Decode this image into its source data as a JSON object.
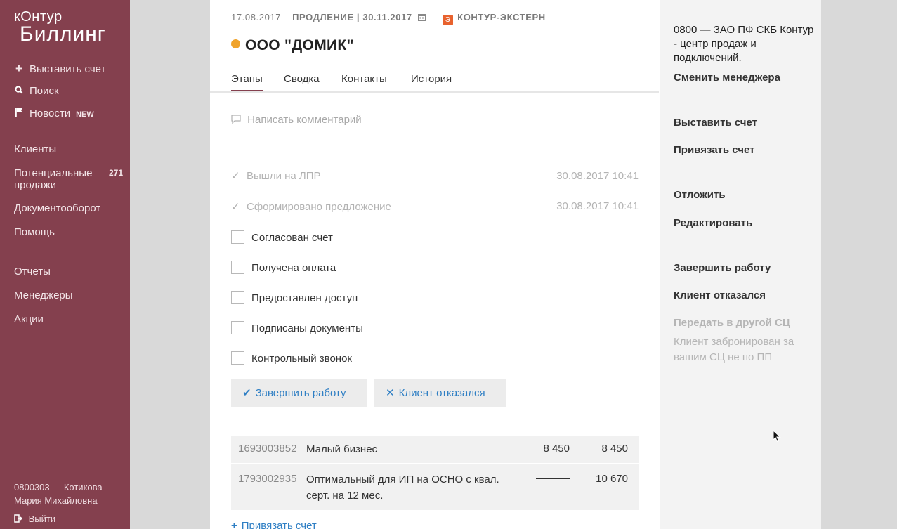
{
  "sidebar": {
    "logo_small": "кОнтур",
    "logo_big": "Биллинг",
    "create_invoice": "Выставить счет",
    "search": "Поиск",
    "news": "Новости",
    "news_badge": "NEW",
    "clients": "Клиенты",
    "potential_sales_line1": "Потенциальные",
    "potential_sales_line2": "продажи",
    "potential_sales_count": "271",
    "docflow": "Документооборот",
    "help": "Помощь",
    "reports": "Отчеты",
    "managers": "Менеджеры",
    "promotions": "Акции",
    "user_line1": "0800303 — Котикова",
    "user_line2": "Мария Михайловна",
    "logout": "Выйти"
  },
  "header": {
    "date": "17.08.2017",
    "renewal": "ПРОДЛЕНИЕ | 30.11.2017",
    "product": "КОНТУР-ЭКСТЕРН",
    "product_icon": "Э",
    "company": "ООО \"ДОМИК\"",
    "status_color": "#f0a32b"
  },
  "tabs": [
    "Этапы",
    "Сводка",
    "Контакты",
    "История"
  ],
  "comment_placeholder": "Написать комментарий",
  "done_steps": [
    {
      "label": "Вышли на ЛПР",
      "time": "30.08.2017 10:41"
    },
    {
      "label": "Сформировано предложение",
      "time": "30.08.2017 10:41"
    }
  ],
  "tasks": [
    "Согласован счет",
    "Получена оплата",
    "Предоставлен доступ",
    "Подписаны документы",
    "Контрольный звонок"
  ],
  "buttons": {
    "finish": "Завершить работу",
    "refused": "Клиент отказался"
  },
  "bills": [
    {
      "number": "1693003852",
      "name": "Малый бизнес",
      "price": "8 450",
      "total": "8 450"
    },
    {
      "number": "1793002935",
      "name": "Оптимальный для ИП на ОСНО с квал. серт. на 12 мес.",
      "price": "",
      "total": "10 670"
    }
  ],
  "bind_bill": "Привязать счет",
  "right": {
    "manager": "0800 — ЗАО ПФ СКБ Контур - центр продаж и подключений.",
    "change_manager": "Сменить менеджера",
    "create_invoice": "Выставить счет",
    "bind_invoice": "Привязать счет",
    "postpone": "Отложить",
    "edit": "Редактировать",
    "finish": "Завершить работу",
    "refused": "Клиент отказался",
    "transfer": "Передать в другой СЦ",
    "note": "Клиент забронирован за вашим СЦ не по ПП"
  },
  "colors": {
    "sidebar": "#84404e",
    "link": "#2f7fc4",
    "accent_product": "#e8622e"
  }
}
